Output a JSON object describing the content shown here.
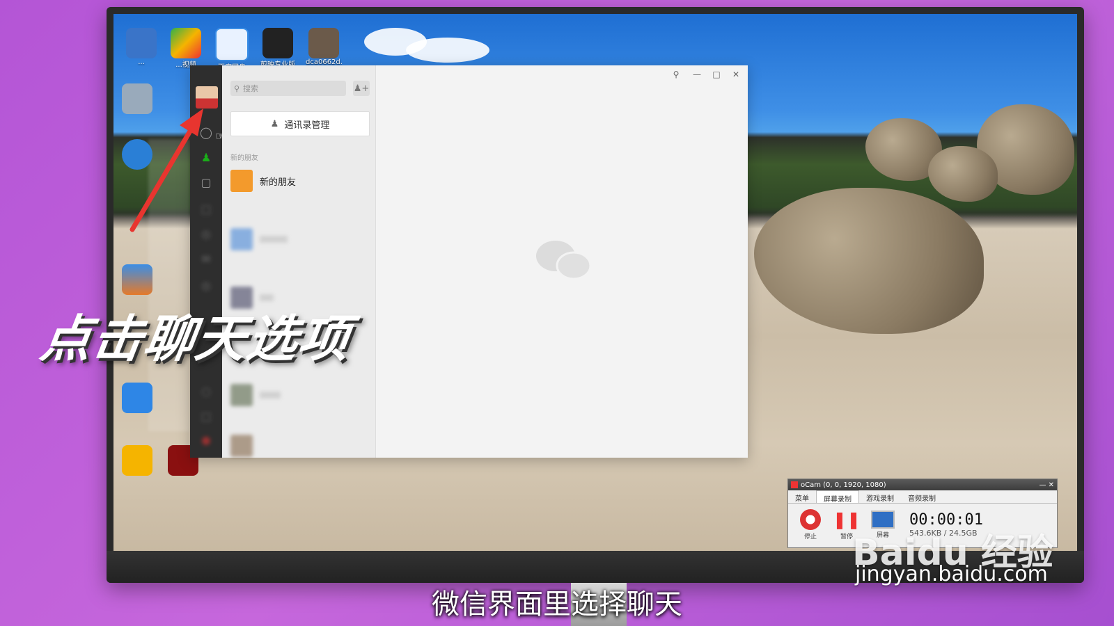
{
  "overlay": {
    "big_caption": "点击聊天选项",
    "subtitle": "微信界面里选择聊天",
    "watermark_brand": "Baidu 经验",
    "watermark_url": "jingyan.baidu.com"
  },
  "desktop": {
    "icons": [
      {
        "label": "...",
        "icon": "computer-icon"
      },
      {
        "label": "...视频",
        "icon": "video-player-icon"
      },
      {
        "label": "百度网盘",
        "icon": "cloud-drive-icon"
      },
      {
        "label": "剪映专业版",
        "icon": "video-editor-icon"
      },
      {
        "label": "dca0662d...",
        "icon": "file-icon"
      }
    ]
  },
  "wechat": {
    "search_placeholder": "搜索",
    "contacts_management_label": "通讯录管理",
    "section_new_friends": "新的朋友",
    "new_friends_item": "新的朋友",
    "window_controls": [
      "pin-icon",
      "minimize-icon",
      "maximize-icon",
      "close-icon"
    ]
  },
  "ocam": {
    "title": "oCam (0, 0, 1920, 1080)",
    "tabs": [
      "菜单",
      "屏幕录制",
      "游戏录制",
      "音频录制"
    ],
    "buttons": [
      {
        "label": "停止",
        "icon": "stop-record-icon"
      },
      {
        "label": "暂停",
        "icon": "pause-icon"
      },
      {
        "label": "屏幕",
        "icon": "screen-icon"
      }
    ],
    "timer": "00:00:01",
    "size": "543.6KB / 24.5GB"
  },
  "colors": {
    "background_purple": "#b455d6",
    "wechat_sidebar": "#2e2e2e",
    "arrow_red": "#e8352f"
  }
}
